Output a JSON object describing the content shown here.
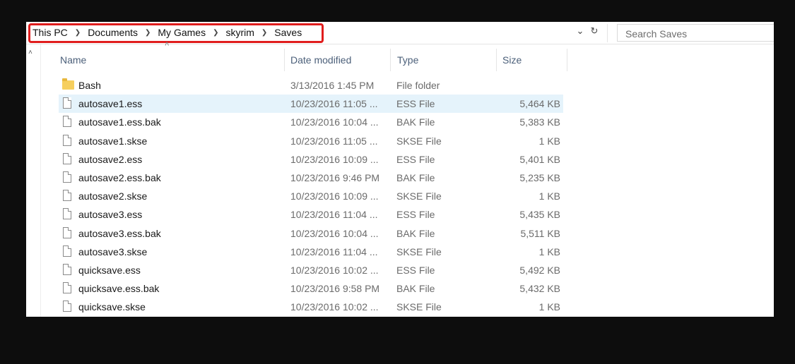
{
  "breadcrumb": [
    "This PC",
    "Documents",
    "My Games",
    "skyrim",
    "Saves"
  ],
  "search": {
    "placeholder": "Search Saves"
  },
  "icons": {
    "dropdown": "chevron-down-icon",
    "refresh": "refresh-icon",
    "scroll_up": "chevron-up-icon",
    "sort": "sort-ascending-icon"
  },
  "columns": {
    "name": "Name",
    "date": "Date modified",
    "type": "Type",
    "size": "Size"
  },
  "files": [
    {
      "name": "Bash",
      "date": "3/13/2016 1:45 PM",
      "type": "File folder",
      "size": "",
      "kind": "folder"
    },
    {
      "name": "autosave1.ess",
      "date": "10/23/2016 11:05 ...",
      "type": "ESS File",
      "size": "5,464 KB",
      "kind": "file"
    },
    {
      "name": "autosave1.ess.bak",
      "date": "10/23/2016 10:04 ...",
      "type": "BAK File",
      "size": "5,383 KB",
      "kind": "file"
    },
    {
      "name": "autosave1.skse",
      "date": "10/23/2016 11:05 ...",
      "type": "SKSE File",
      "size": "1 KB",
      "kind": "file"
    },
    {
      "name": "autosave2.ess",
      "date": "10/23/2016 10:09 ...",
      "type": "ESS File",
      "size": "5,401 KB",
      "kind": "file"
    },
    {
      "name": "autosave2.ess.bak",
      "date": "10/23/2016 9:46 PM",
      "type": "BAK File",
      "size": "5,235 KB",
      "kind": "file"
    },
    {
      "name": "autosave2.skse",
      "date": "10/23/2016 10:09 ...",
      "type": "SKSE File",
      "size": "1 KB",
      "kind": "file"
    },
    {
      "name": "autosave3.ess",
      "date": "10/23/2016 11:04 ...",
      "type": "ESS File",
      "size": "5,435 KB",
      "kind": "file"
    },
    {
      "name": "autosave3.ess.bak",
      "date": "10/23/2016 10:04 ...",
      "type": "BAK File",
      "size": "5,511 KB",
      "kind": "file"
    },
    {
      "name": "autosave3.skse",
      "date": "10/23/2016 11:04 ...",
      "type": "SKSE File",
      "size": "1 KB",
      "kind": "file"
    },
    {
      "name": "quicksave.ess",
      "date": "10/23/2016 10:02 ...",
      "type": "ESS File",
      "size": "5,492 KB",
      "kind": "file"
    },
    {
      "name": "quicksave.ess.bak",
      "date": "10/23/2016 9:58 PM",
      "type": "BAK File",
      "size": "5,432 KB",
      "kind": "file"
    },
    {
      "name": "quicksave.skse",
      "date": "10/23/2016 10:02 ...",
      "type": "SKSE File",
      "size": "1 KB",
      "kind": "file"
    }
  ],
  "selected_row": 1,
  "colors": {
    "highlight_box": "#e01d1d",
    "selected_row": "#e5f3fb",
    "folder": "#f6cf5e"
  }
}
